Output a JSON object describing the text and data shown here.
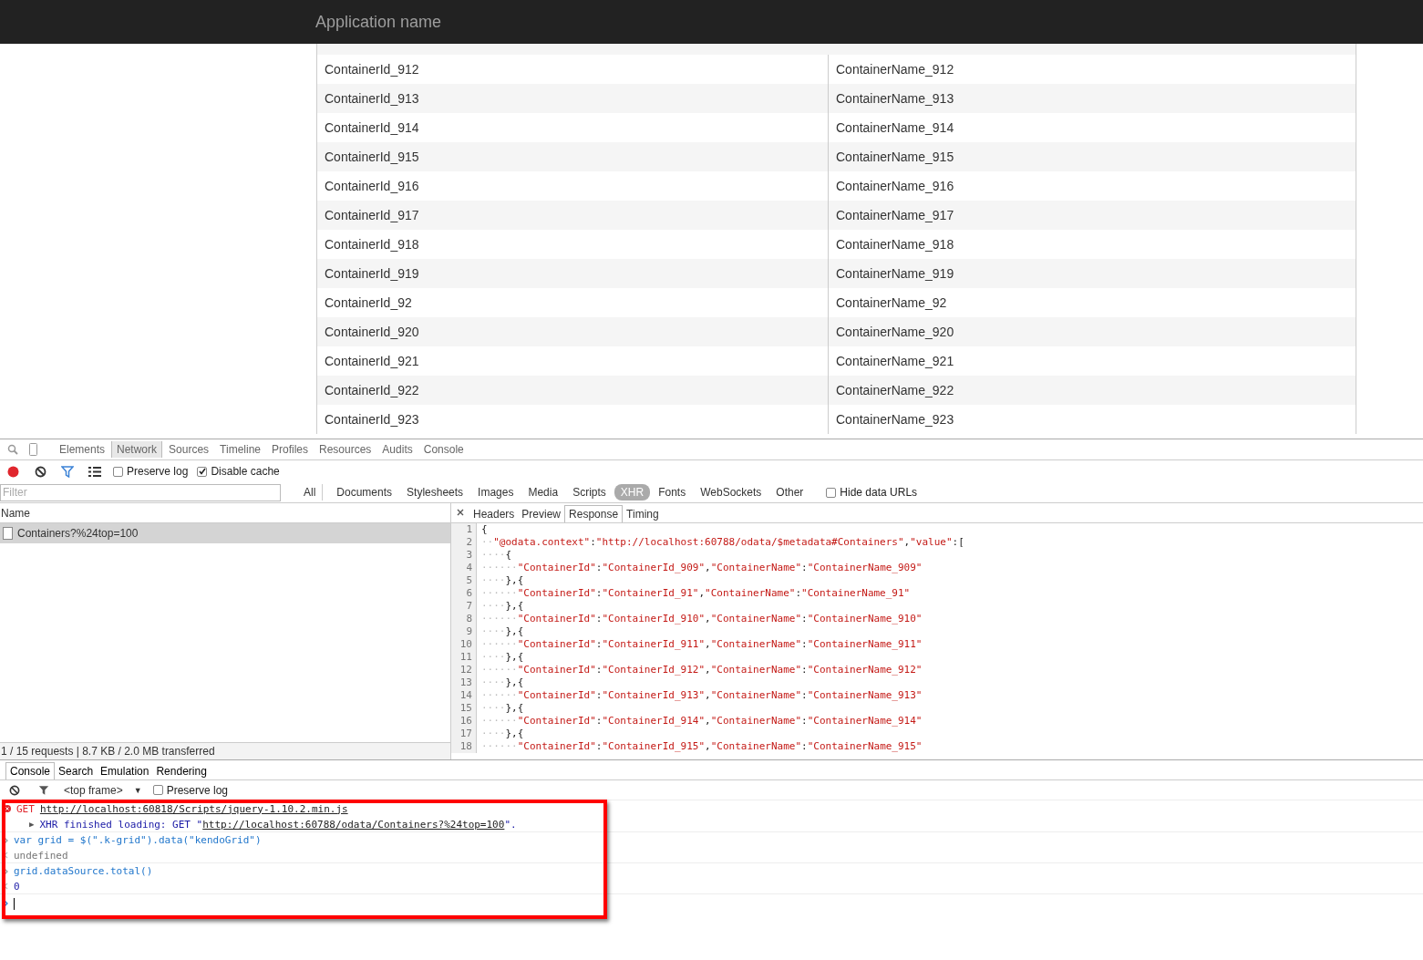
{
  "app": {
    "title": "Application name"
  },
  "grid": {
    "rows": [
      {
        "id": "ContainerId_912",
        "name": "ContainerName_912"
      },
      {
        "id": "ContainerId_913",
        "name": "ContainerName_913"
      },
      {
        "id": "ContainerId_914",
        "name": "ContainerName_914"
      },
      {
        "id": "ContainerId_915",
        "name": "ContainerName_915"
      },
      {
        "id": "ContainerId_916",
        "name": "ContainerName_916"
      },
      {
        "id": "ContainerId_917",
        "name": "ContainerName_917"
      },
      {
        "id": "ContainerId_918",
        "name": "ContainerName_918"
      },
      {
        "id": "ContainerId_919",
        "name": "ContainerName_919"
      },
      {
        "id": "ContainerId_92",
        "name": "ContainerName_92"
      },
      {
        "id": "ContainerId_920",
        "name": "ContainerName_920"
      },
      {
        "id": "ContainerId_921",
        "name": "ContainerName_921"
      },
      {
        "id": "ContainerId_922",
        "name": "ContainerName_922"
      },
      {
        "id": "ContainerId_923",
        "name": "ContainerName_923"
      }
    ]
  },
  "devtools": {
    "tabs": [
      {
        "label": "Elements",
        "selected": false
      },
      {
        "label": "Network",
        "selected": true
      },
      {
        "label": "Sources",
        "selected": false
      },
      {
        "label": "Timeline",
        "selected": false
      },
      {
        "label": "Profiles",
        "selected": false
      },
      {
        "label": "Resources",
        "selected": false
      },
      {
        "label": "Audits",
        "selected": false
      },
      {
        "label": "Console",
        "selected": false
      }
    ],
    "toolbar": {
      "options": [
        {
          "label": "Preserve log",
          "checked": false
        },
        {
          "label": "Disable cache",
          "checked": true
        }
      ]
    },
    "filter": {
      "placeholder": "Filter"
    },
    "types": [
      {
        "label": "All",
        "selected": false
      },
      {
        "label": "Documents",
        "selected": false
      },
      {
        "label": "Stylesheets",
        "selected": false
      },
      {
        "label": "Images",
        "selected": false
      },
      {
        "label": "Media",
        "selected": false
      },
      {
        "label": "Scripts",
        "selected": false
      },
      {
        "label": "XHR",
        "selected": true
      },
      {
        "label": "Fonts",
        "selected": false
      },
      {
        "label": "WebSockets",
        "selected": false
      },
      {
        "label": "Other",
        "selected": false
      }
    ],
    "hide_data_urls": {
      "label": "Hide data URLs",
      "checked": false
    },
    "requests": {
      "header": "Name",
      "items": [
        {
          "name": "Containers?%24top=100",
          "selected": true
        }
      ],
      "status": "1 / 15 requests | 8.7 KB / 2.0 MB transferred"
    },
    "detail_tabs": [
      {
        "label": "Headers",
        "selected": false
      },
      {
        "label": "Preview",
        "selected": false
      },
      {
        "label": "Response",
        "selected": true
      },
      {
        "label": "Timing",
        "selected": false
      }
    ],
    "response_lines": [
      {
        "number": "1",
        "text": "{"
      },
      {
        "number": "2",
        "text": "··\"@odata.context\":\"http://localhost:60788/odata/$metadata#Containers\",\"value\":["
      },
      {
        "number": "3",
        "text": "····{"
      },
      {
        "number": "4",
        "text": "······\"ContainerId\":\"ContainerId_909\",\"ContainerName\":\"ContainerName_909\""
      },
      {
        "number": "5",
        "text": "····},{"
      },
      {
        "number": "6",
        "text": "······\"ContainerId\":\"ContainerId_91\",\"ContainerName\":\"ContainerName_91\""
      },
      {
        "number": "7",
        "text": "····},{"
      },
      {
        "number": "8",
        "text": "······\"ContainerId\":\"ContainerId_910\",\"ContainerName\":\"ContainerName_910\""
      },
      {
        "number": "9",
        "text": "····},{"
      },
      {
        "number": "10",
        "text": "······\"ContainerId\":\"ContainerId_911\",\"ContainerName\":\"ContainerName_911\""
      },
      {
        "number": "11",
        "text": "····},{"
      },
      {
        "number": "12",
        "text": "······\"ContainerId\":\"ContainerId_912\",\"ContainerName\":\"ContainerName_912\""
      },
      {
        "number": "13",
        "text": "····},{"
      },
      {
        "number": "14",
        "text": "······\"ContainerId\":\"ContainerId_913\",\"ContainerName\":\"ContainerName_913\""
      },
      {
        "number": "15",
        "text": "····},{"
      },
      {
        "number": "16",
        "text": "······\"ContainerId\":\"ContainerId_914\",\"ContainerName\":\"ContainerName_914\""
      },
      {
        "number": "17",
        "text": "····},{"
      },
      {
        "number": "18",
        "text": "······\"ContainerId\":\"ContainerId_915\",\"ContainerName\":\"ContainerName_915\""
      }
    ],
    "drawer_tabs": [
      {
        "label": "Console",
        "selected": true
      },
      {
        "label": "Search",
        "selected": false
      },
      {
        "label": "Emulation",
        "selected": false
      },
      {
        "label": "Rendering",
        "selected": false
      }
    ],
    "console": {
      "context": "<top frame>",
      "arrow": "▼",
      "preserve_log": {
        "label": "Preserve log",
        "checked": false
      },
      "entries": [
        {
          "kind": "error",
          "prefix": "GET",
          "link": "http://localhost:60818/Scripts/jquery-1.10.2.min.js"
        },
        {
          "kind": "xhr",
          "arrow": "▶",
          "prefix": "XHR finished loading: GET \"",
          "link": "http://localhost:60788/odata/Containers?%24top=100",
          "suffix": "\"."
        },
        {
          "kind": "input",
          "text": "var grid = $(\".k-grid\").data(\"kendoGrid\")"
        },
        {
          "kind": "output",
          "text": "undefined"
        },
        {
          "kind": "input",
          "text": "grid.dataSource.total()"
        },
        {
          "kind": "number",
          "text": "0"
        },
        {
          "kind": "prompt"
        }
      ]
    }
  }
}
